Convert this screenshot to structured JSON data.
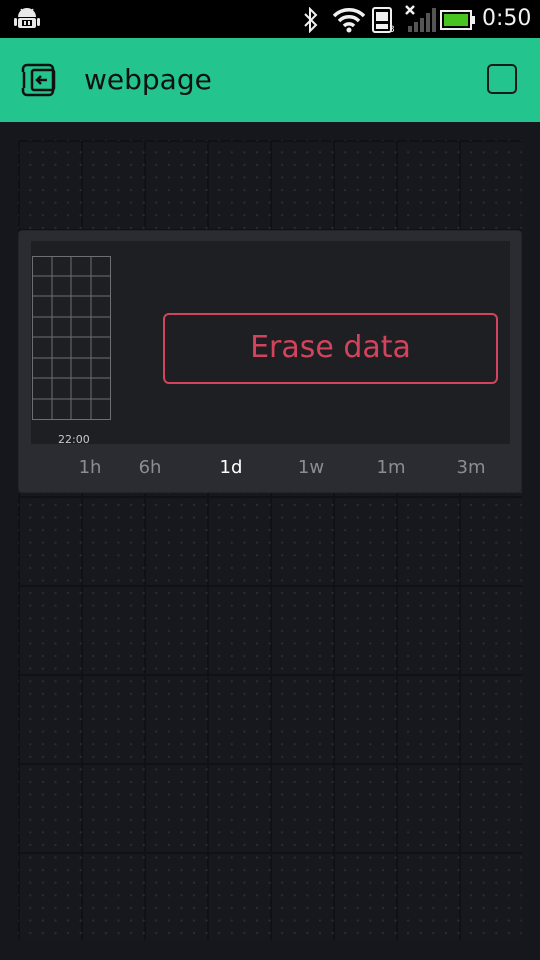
{
  "status_bar": {
    "time": "0:50",
    "icons": [
      "android-debug-icon",
      "bluetooth-icon",
      "wifi-icon",
      "sim-icon",
      "signal-icon",
      "battery-icon"
    ]
  },
  "app_bar": {
    "title": "webpage",
    "color": "#23c48e",
    "left_icon": "exit-icon",
    "right_icon": "square-icon"
  },
  "widget": {
    "chart": {
      "x_tick": "22:00"
    },
    "erase_label": "Erase data",
    "erase_color": "#d3435c",
    "ranges": [
      "1h",
      "6h",
      "1d",
      "1w",
      "1m",
      "3m"
    ],
    "active_range": "1d"
  }
}
